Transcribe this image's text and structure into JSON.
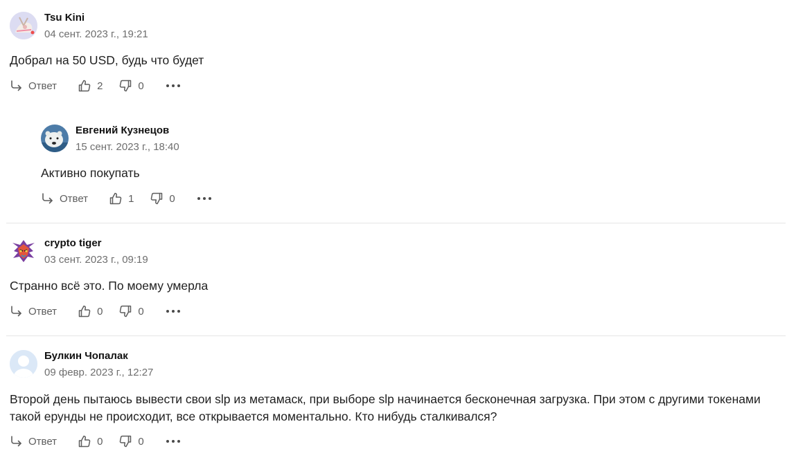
{
  "comments": [
    {
      "author": "Tsu Kini",
      "date": "04 сент. 2023 г., 19:21",
      "text": "Добрал на 50 USD, будь что будет",
      "reply_label": "Ответ",
      "likes": "2",
      "dislikes": "0",
      "avatar": "anime-avatar"
    },
    {
      "author": "Евгений Кузнецов",
      "date": "15 сент. 2023 г., 18:40",
      "text": "Активно покупать",
      "reply_label": "Ответ",
      "likes": "1",
      "dislikes": "0",
      "avatar": "polar-bear-avatar"
    },
    {
      "author": "crypto tiger",
      "date": "03 сент. 2023 г., 09:19",
      "text": "Странно всё это. По моему умерла",
      "reply_label": "Ответ",
      "likes": "0",
      "dislikes": "0",
      "avatar": "tiger-avatar"
    },
    {
      "author": "Булкин Чопалак",
      "date": "09 февр. 2023 г., 12:27",
      "text": "Второй день пытаюсь вывести свои slp из метамаск, при выборе slp начинается бесконечная загрузка. При этом с другими токенами такой ерунды не происходит, все открывается моментально. Кто нибудь сталкивался?",
      "reply_label": "Ответ",
      "likes": "0",
      "dislikes": "0",
      "avatar": "default-user-avatar"
    }
  ]
}
